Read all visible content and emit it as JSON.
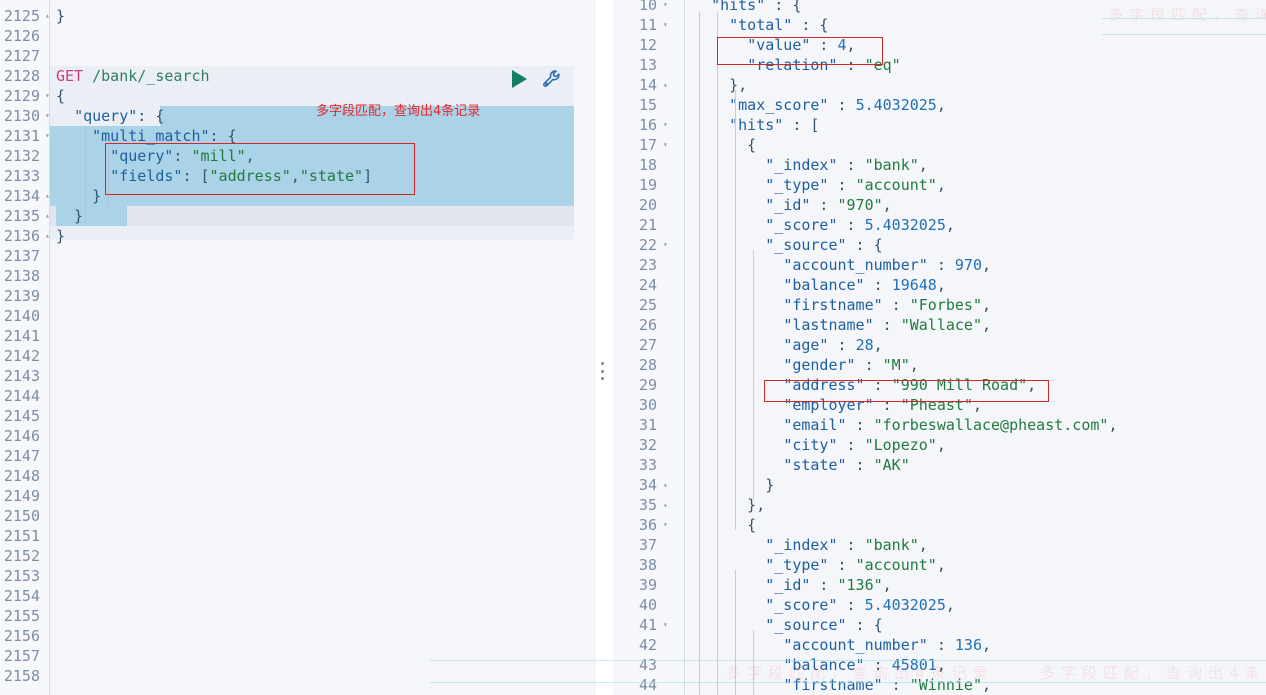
{
  "app": {
    "name": "kibana-dev-tools-console",
    "colors": {
      "background": "#f5f6fa",
      "gutter": "#f7f8fb",
      "selection": "#abd3e8",
      "request_block": "#eceef5",
      "current_line": "#e3e5ee",
      "annotation": "#d82626",
      "play_icon": "#128067",
      "wrench_icon": "#2f6fb5",
      "method_token": "#cf3a7c",
      "string_token": "#217a3f",
      "key_token": "#1f5fa0",
      "number_token": "#1f6fb8"
    }
  },
  "editor": {
    "name": "request-editor",
    "first_line_number": 2125,
    "last_line_number": 2158,
    "line_numbers": [
      "2125",
      "2126",
      "2127",
      "2128",
      "2129",
      "2130",
      "2131",
      "2132",
      "2133",
      "2134",
      "2135",
      "2136",
      "2137",
      "2138",
      "2139",
      "2140",
      "2141",
      "2142",
      "2143",
      "2144",
      "2145",
      "2146",
      "2147",
      "2148",
      "2149",
      "2150",
      "2151",
      "2152",
      "2153",
      "2154",
      "2155",
      "2156",
      "2157",
      "2158"
    ],
    "lines": [
      {
        "n": "2125",
        "fold": "up",
        "text": "}"
      },
      {
        "n": "2126",
        "fold": "",
        "text": ""
      },
      {
        "n": "2127",
        "fold": "",
        "text": ""
      },
      {
        "n": "2128",
        "fold": "",
        "method": "GET",
        "url": "/bank/_search"
      },
      {
        "n": "2129",
        "fold": "down",
        "text": "{"
      },
      {
        "n": "2130",
        "fold": "down",
        "text": "  \"query\": {"
      },
      {
        "n": "2131",
        "fold": "down",
        "text": "    \"multi_match\": {"
      },
      {
        "n": "2132",
        "fold": "",
        "text": "      \"query\": \"mill\","
      },
      {
        "n": "2133",
        "fold": "",
        "text": "      \"fields\": [\"address\",\"state\"]"
      },
      {
        "n": "2134",
        "fold": "up",
        "text": "    }"
      },
      {
        "n": "2135",
        "fold": "up",
        "text": "  }"
      },
      {
        "n": "2136",
        "fold": "up",
        "text": "}"
      },
      {
        "n": "2137",
        "fold": "",
        "text": ""
      },
      {
        "n": "2138",
        "fold": "",
        "text": ""
      },
      {
        "n": "2139",
        "fold": "",
        "text": ""
      },
      {
        "n": "2140",
        "fold": "",
        "text": ""
      },
      {
        "n": "2141",
        "fold": "",
        "text": ""
      },
      {
        "n": "2142",
        "fold": "",
        "text": ""
      },
      {
        "n": "2143",
        "fold": "",
        "text": ""
      },
      {
        "n": "2144",
        "fold": "",
        "text": ""
      },
      {
        "n": "2145",
        "fold": "",
        "text": ""
      },
      {
        "n": "2146",
        "fold": "",
        "text": ""
      },
      {
        "n": "2147",
        "fold": "",
        "text": ""
      },
      {
        "n": "2148",
        "fold": "",
        "text": ""
      },
      {
        "n": "2149",
        "fold": "",
        "text": ""
      },
      {
        "n": "2150",
        "fold": "",
        "text": ""
      },
      {
        "n": "2151",
        "fold": "",
        "text": ""
      },
      {
        "n": "2152",
        "fold": "",
        "text": ""
      },
      {
        "n": "2153",
        "fold": "",
        "text": ""
      },
      {
        "n": "2154",
        "fold": "",
        "text": ""
      },
      {
        "n": "2155",
        "fold": "",
        "text": ""
      },
      {
        "n": "2156",
        "fold": "",
        "text": ""
      },
      {
        "n": "2157",
        "fold": "",
        "text": ""
      },
      {
        "n": "2158",
        "fold": "",
        "text": ""
      }
    ],
    "request": {
      "method": "GET",
      "path": "/bank/_search",
      "body_line_1": "{",
      "body_line_2": "  \"query\": {",
      "body_line_3": "    \"multi_match\": {",
      "body_line_4_key": "      \"query\"",
      "body_line_4_val": "\"mill\"",
      "body_line_5_key": "      \"fields\"",
      "body_line_5_val": "[\"address\",\"state\"]",
      "body_line_6": "    }",
      "body_line_7": "  }",
      "body_line_8": "}"
    },
    "actions": {
      "play_label": "Click to send request",
      "wrench_label": "Open documentation / auto indent"
    }
  },
  "annotation": {
    "note": "多字段匹配，查询出4条记录",
    "boxes": [
      "query-fields-box",
      "total-value-box",
      "address-box"
    ]
  },
  "response": {
    "name": "response-viewer",
    "first_line_number": 10,
    "lines": [
      {
        "n": "10",
        "fold": "down",
        "text": "  \"hits\" : {"
      },
      {
        "n": "11",
        "fold": "down",
        "text": "    \"total\" : {"
      },
      {
        "n": "12",
        "fold": "",
        "text": "      \"value\" : 4,"
      },
      {
        "n": "13",
        "fold": "",
        "text": "      \"relation\" : \"eq\""
      },
      {
        "n": "14",
        "fold": "up",
        "text": "    },"
      },
      {
        "n": "15",
        "fold": "",
        "text": "    \"max_score\" : 5.4032025,"
      },
      {
        "n": "16",
        "fold": "down",
        "text": "    \"hits\" : ["
      },
      {
        "n": "17",
        "fold": "down",
        "text": "      {"
      },
      {
        "n": "18",
        "fold": "",
        "text": "        \"_index\" : \"bank\","
      },
      {
        "n": "19",
        "fold": "",
        "text": "        \"_type\" : \"account\","
      },
      {
        "n": "20",
        "fold": "",
        "text": "        \"_id\" : \"970\","
      },
      {
        "n": "21",
        "fold": "",
        "text": "        \"_score\" : 5.4032025,"
      },
      {
        "n": "22",
        "fold": "down",
        "text": "        \"_source\" : {"
      },
      {
        "n": "23",
        "fold": "",
        "text": "          \"account_number\" : 970,"
      },
      {
        "n": "24",
        "fold": "",
        "text": "          \"balance\" : 19648,"
      },
      {
        "n": "25",
        "fold": "",
        "text": "          \"firstname\" : \"Forbes\","
      },
      {
        "n": "26",
        "fold": "",
        "text": "          \"lastname\" : \"Wallace\","
      },
      {
        "n": "27",
        "fold": "",
        "text": "          \"age\" : 28,"
      },
      {
        "n": "28",
        "fold": "",
        "text": "          \"gender\" : \"M\","
      },
      {
        "n": "29",
        "fold": "",
        "text": "          \"address\" : \"990 Mill Road\","
      },
      {
        "n": "30",
        "fold": "",
        "text": "          \"employer\" : \"Pheast\","
      },
      {
        "n": "31",
        "fold": "",
        "text": "          \"email\" : \"forbeswallace@pheast.com\","
      },
      {
        "n": "32",
        "fold": "",
        "text": "          \"city\" : \"Lopezo\","
      },
      {
        "n": "33",
        "fold": "",
        "text": "          \"state\" : \"AK\""
      },
      {
        "n": "34",
        "fold": "up",
        "text": "        }"
      },
      {
        "n": "35",
        "fold": "up",
        "text": "      },"
      },
      {
        "n": "36",
        "fold": "down",
        "text": "      {"
      },
      {
        "n": "37",
        "fold": "",
        "text": "        \"_index\" : \"bank\","
      },
      {
        "n": "38",
        "fold": "",
        "text": "        \"_type\" : \"account\","
      },
      {
        "n": "39",
        "fold": "",
        "text": "        \"_id\" : \"136\","
      },
      {
        "n": "40",
        "fold": "",
        "text": "        \"_score\" : 5.4032025,"
      },
      {
        "n": "41",
        "fold": "down",
        "text": "        \"_source\" : {"
      },
      {
        "n": "42",
        "fold": "",
        "text": "          \"account_number\" : 136,"
      },
      {
        "n": "43",
        "fold": "",
        "text": "          \"balance\" : 45801,"
      },
      {
        "n": "44",
        "fold": "",
        "text": "          \"firstname\" : \"Winnie\","
      }
    ],
    "hits_total_value": "4",
    "hits_total_relation": "eq",
    "max_score": "5.4032025",
    "documents": [
      {
        "_index": "bank",
        "_type": "account",
        "_id": "970",
        "_score": "5.4032025",
        "account_number": "970",
        "balance": "19648",
        "firstname": "Forbes",
        "lastname": "Wallace",
        "age": "28",
        "gender": "M",
        "address": "990 Mill Road",
        "employer": "Pheast",
        "email": "forbeswallace@pheast.com",
        "city": "Lopezo",
        "state": "AK"
      },
      {
        "_index": "bank",
        "_type": "account",
        "_id": "136",
        "_score": "5.4032025",
        "account_number": "136",
        "balance": "45801",
        "firstname": "Winnie"
      }
    ]
  },
  "watermark": {
    "text": "多字段匹配，查询出4条记录"
  }
}
